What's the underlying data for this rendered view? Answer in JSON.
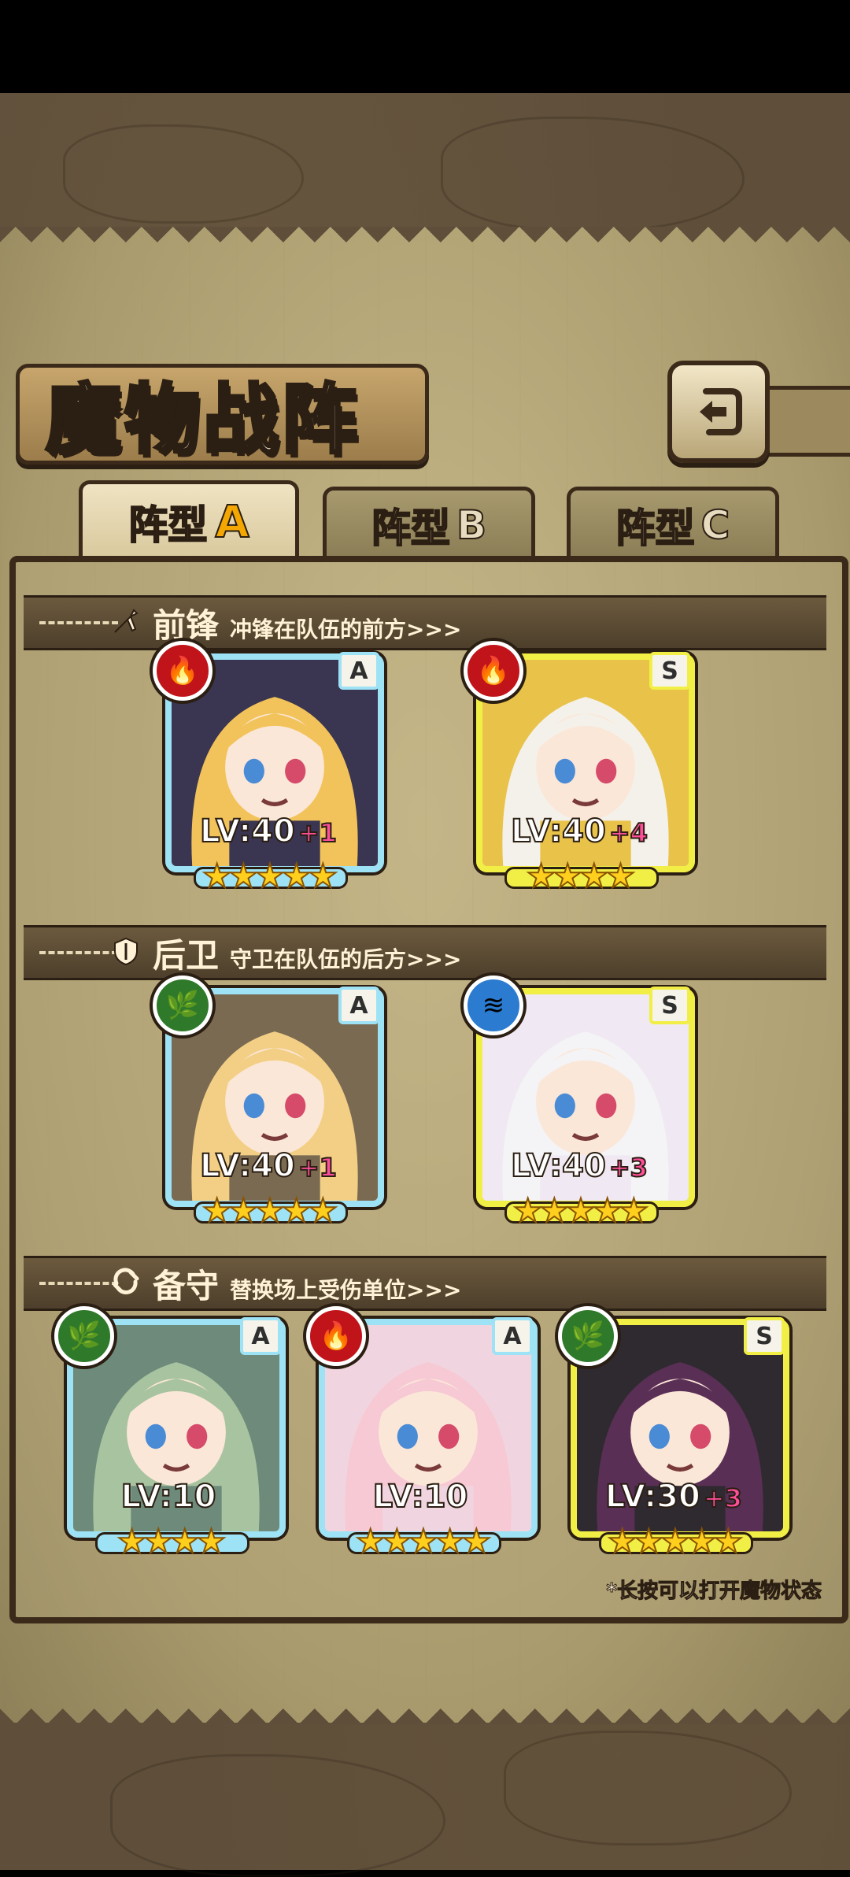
{
  "title": "魔物战阵",
  "back_icon": "return-arrow-icon",
  "tabs": [
    {
      "prefix": "阵型",
      "suffix": "A",
      "active": true
    },
    {
      "prefix": "阵型",
      "suffix": "B",
      "active": false
    },
    {
      "prefix": "阵型",
      "suffix": "C",
      "active": false
    }
  ],
  "sections": {
    "front": {
      "name": "前锋",
      "desc": "冲锋在队伍的前方>>>",
      "icon": "sword-icon"
    },
    "back": {
      "name": "后卫",
      "desc": "守卫在队伍的后方>>>",
      "icon": "shield-icon"
    },
    "reserve": {
      "name": "备守",
      "desc": "替换场上受伤单位>>>",
      "icon": "swap-icon"
    }
  },
  "cards": [
    {
      "grade": "A",
      "element": "fire",
      "level": "LV:40",
      "plus": "+1",
      "stars": "★★★★★",
      "hair": "#f2c35a",
      "outfit": "#3a3550"
    },
    {
      "grade": "S",
      "element": "fire",
      "level": "LV:40",
      "plus": "+4",
      "stars": "★★★★",
      "hair": "#f4f1ea",
      "outfit": "#e9c24a"
    },
    {
      "grade": "A",
      "element": "wood",
      "level": "LV:40",
      "plus": "+1",
      "stars": "★★★★★",
      "hair": "#f3cf86",
      "outfit": "#7a6a52"
    },
    {
      "grade": "S",
      "element": "water",
      "level": "LV:40",
      "plus": "+3",
      "stars": "★★★★★",
      "hair": "#f4f3f6",
      "outfit": "#f0e8f2"
    },
    {
      "grade": "A",
      "element": "wood",
      "level": "LV:10",
      "plus": "",
      "stars": "★★★★",
      "hair": "#a8c3a0",
      "outfit": "#6d8a7a"
    },
    {
      "grade": "A",
      "element": "fire",
      "level": "LV:10",
      "plus": "",
      "stars": "★★★★★",
      "hair": "#f6c9d4",
      "outfit": "#f0d5e0"
    },
    {
      "grade": "S",
      "element": "wood",
      "level": "LV:30",
      "plus": "+3",
      "stars": "★★★★★",
      "hair": "#5a2f55",
      "outfit": "#2f2a30"
    }
  ],
  "element_colors": {
    "fire": "#c0141a",
    "wood": "#2f7a2a",
    "water": "#2b7bd1"
  },
  "element_glyphs": {
    "fire": "🔥",
    "wood": "🌿",
    "water": "≋"
  },
  "hint": "*长按可以打开魔物状态"
}
